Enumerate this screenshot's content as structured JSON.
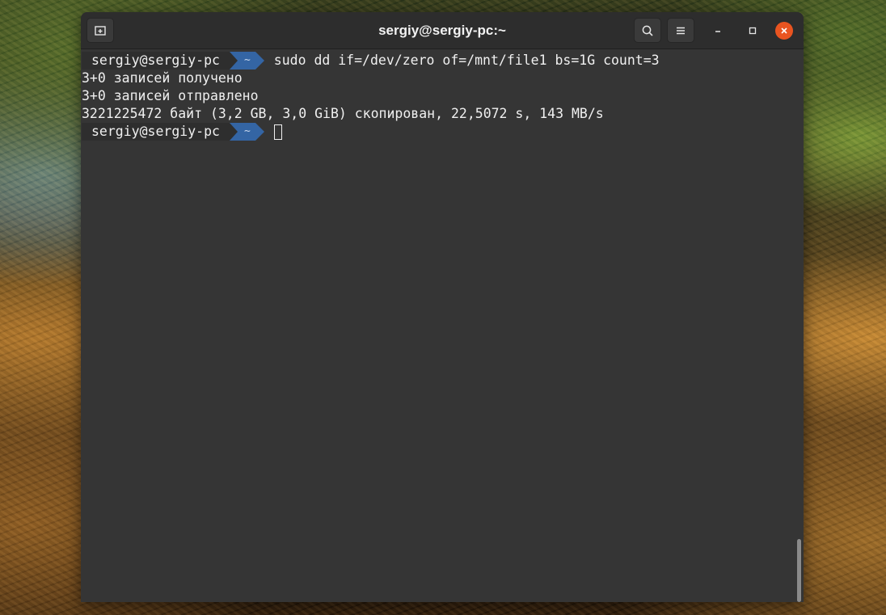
{
  "window": {
    "title": "sergiy@sergiy-pc:~",
    "accent_close": "#e95420"
  },
  "icons": {
    "new_tab": "new-tab-icon",
    "search": "search-icon",
    "menu": "hamburger-menu-icon",
    "minimize": "minimize-icon",
    "maximize": "maximize-icon",
    "close": "close-icon"
  },
  "terminal": {
    "prompt_user": "sergiy@sergiy-pc",
    "prompt_dir": "~",
    "prompt_dir_color": "#3465a4",
    "command": "sudo dd if=/dev/zero of=/mnt/file1 bs=1G count=3",
    "output": [
      "3+0 записей получено",
      "3+0 записей отправлено",
      "3221225472 байт (3,2 GB, 3,0 GiB) скопирован, 22,5072 s, 143 MB/s"
    ]
  }
}
